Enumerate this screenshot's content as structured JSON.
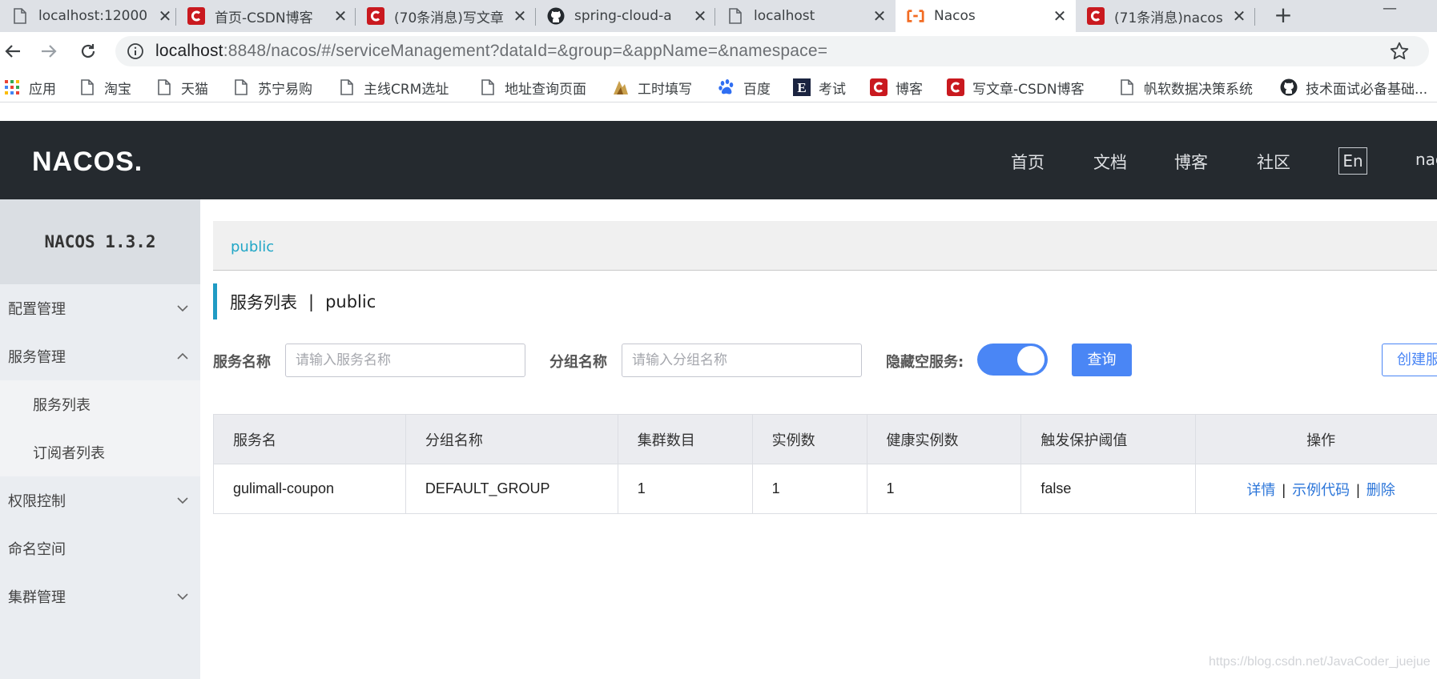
{
  "browser": {
    "tabs": [
      {
        "label": "localhost:12000",
        "icon": "page-icon"
      },
      {
        "label": "首页-CSDN博客",
        "icon": "csdn-icon"
      },
      {
        "label": "(70条消息)写文章",
        "icon": "csdn-icon"
      },
      {
        "label": "spring-cloud-a",
        "icon": "github-icon"
      },
      {
        "label": "localhost",
        "icon": "page-icon"
      },
      {
        "label": "Nacos",
        "icon": "nacos-icon"
      },
      {
        "label": "(71条消息)nacos",
        "icon": "csdn-icon"
      }
    ],
    "tab_close": "✕",
    "new_tab": "+",
    "minimize": "—",
    "url_host": "localhost",
    "url_rest": ":8848/nacos/#/serviceManagement?dataId=&group=&appName=&namespace=",
    "bookmarks": [
      {
        "label": "应用",
        "icon": "apps-grid-icon"
      },
      {
        "label": "淘宝",
        "icon": "page-icon"
      },
      {
        "label": "天猫",
        "icon": "page-icon"
      },
      {
        "label": "苏宁易购",
        "icon": "page-icon"
      },
      {
        "label": "主线CRM选址",
        "icon": "page-icon"
      },
      {
        "label": "地址查询页面",
        "icon": "page-icon"
      },
      {
        "label": "工时填写",
        "icon": "timesheet-icon"
      },
      {
        "label": "百度",
        "icon": "baidu-paw-icon"
      },
      {
        "label": "考试",
        "icon": "e-icon"
      },
      {
        "label": "博客",
        "icon": "csdn-icon"
      },
      {
        "label": "写文章-CSDN博客",
        "icon": "csdn-icon"
      },
      {
        "label": "帆软数据决策系统",
        "icon": "page-icon"
      },
      {
        "label": "技术面试必备基础...",
        "icon": "github-icon"
      }
    ]
  },
  "header": {
    "logo_text": "NACOS.",
    "nav": [
      "首页",
      "文档",
      "博客",
      "社区"
    ],
    "lang_button": "En",
    "user_text": "nacos"
  },
  "sidebar": {
    "title": "NACOS 1.3.2",
    "items": [
      {
        "label": "配置管理",
        "chevron": "down"
      },
      {
        "label": "服务管理",
        "chevron": "up"
      },
      {
        "label": "服务列表",
        "chevron": ""
      },
      {
        "label": "订阅者列表",
        "chevron": ""
      },
      {
        "label": "权限控制",
        "chevron": "down"
      },
      {
        "label": "命名空间",
        "chevron": ""
      },
      {
        "label": "集群管理",
        "chevron": "down"
      }
    ]
  },
  "main": {
    "namespace_tab": "public",
    "title": "服务列表",
    "title_sep": "|",
    "title_ns": "public",
    "filters": {
      "service_label": "服务名称",
      "service_placeholder": "请输入服务名称",
      "group_label": "分组名称",
      "group_placeholder": "请输入分组名称",
      "hide_empty_label": "隐藏空服务:",
      "hide_empty_on": true,
      "query_button": "查询",
      "create_button": "创建服务"
    },
    "table": {
      "columns": [
        "服务名",
        "分组名称",
        "集群数目",
        "实例数",
        "健康实例数",
        "触发保护阈值",
        "操作"
      ],
      "rows": [
        {
          "name": "gulimall-coupon",
          "group": "DEFAULT_GROUP",
          "clusters": "1",
          "instances": "1",
          "healthy": "1",
          "threshold": "false",
          "actions": [
            "详情",
            "示例代码",
            "删除"
          ],
          "action_sep": "|"
        }
      ]
    }
  },
  "watermark": "https://blog.csdn.net/JavaCoder_juejue",
  "colors": {
    "header_bg": "#252a2f",
    "accent_blue": "#4a86f5",
    "link_blue": "#2b75d9",
    "crumb_cyan": "#20a6c6",
    "title_bar": "#209bc4"
  }
}
